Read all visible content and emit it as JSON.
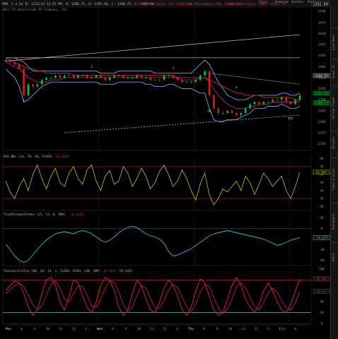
{
  "header": {
    "symbol": "SPX",
    "timeframe": "5 d 5m",
    "bar_info": "D: 3/22/12 12:35 PM, O: 1396.75, H: 1392.86, L: 1390.73, C: 1392.94",
    "study_a": "SimpleMovingAvg (20, CLOSE, 0)",
    "study_b": "SimpleMovingAvg (200, CLOSE, 0)",
    "study_c": "SimpleMovingAvg (1000, CLOSE, 0)",
    "copyright": "2012 TD Ameritrade IP Company, Inc.",
    "toolbar": [
      "Style",
      "Drawings",
      "Studies",
      "Patterns"
    ],
    "last_price": "1392.94"
  },
  "sidebar": {
    "tabs": [
      "Live News",
      "Level II",
      "Active Trader",
      "Options",
      "Times & Sales",
      "Dashboard",
      "Watch"
    ]
  },
  "price_panel": {
    "y_labels": [
      "1430",
      "1425",
      "1420",
      "1415",
      "1410",
      "1405",
      "1400",
      "1395",
      "1390",
      "1385",
      "1380",
      "1375",
      "1370"
    ],
    "markers": [
      "1",
      "2",
      "3",
      "4",
      "16",
      "E?F"
    ],
    "price_tags": [
      {
        "text": "1400.93",
        "color": "#cccccc"
      },
      {
        "text": "1392.94",
        "color": "#00cc44"
      },
      {
        "text": "1389.57",
        "color": "#00cc44"
      }
    ]
  },
  "rsi_panel": {
    "title": "RSI_BBs (14, 70, 30, CLOSE)",
    "value": "62.8419",
    "badge": "62.847",
    "levels": [
      "80",
      "70",
      "60",
      "50",
      "40",
      "30",
      "20"
    ]
  },
  "tsi_panel": {
    "title": "TrueStrengthIndex (25, 13, 8, EMA)",
    "value": "-16.8243",
    "badge": "-16.824",
    "levels": [
      "20",
      "0",
      "-20",
      "-40",
      "-60"
    ]
  },
  "stoch_panel": {
    "title": "StochasticSlow (80, 20, 14, 3, CLOSE, HIGH, LOW, SMA)",
    "values": [
      "82.0947",
      "59.4435"
    ],
    "badges": [
      "82.09",
      "59.44"
    ],
    "levels": [
      "100",
      "80",
      "60",
      "40",
      "20",
      "0"
    ]
  },
  "x_axis": {
    "ticks": [
      "Mon",
      "8",
      "9",
      "10",
      "11",
      "12",
      "1:",
      "Wed",
      "8",
      "9",
      "10",
      "11",
      "12",
      "1:",
      "Thu",
      "8",
      "9",
      "10",
      "11",
      "12",
      "1:",
      "Fri",
      "8"
    ]
  },
  "colors": {
    "background": "#000000",
    "candle_up": "#00cc33",
    "candle_down": "#dd2222",
    "bollinger": "#8899ee",
    "ma_magenta": "#cc2288",
    "ma_red": "#ee3333",
    "rsi_line": "#ccbb33",
    "tsi_line": "#33bbcc",
    "stoch_k": "#ee2222",
    "stoch_d": "#aa2266",
    "level_red": "#cc2222",
    "level_cyan": "#33cccc"
  },
  "chart_data": [
    {
      "type": "line",
      "name": "price",
      "ylim": [
        1367,
        1432
      ],
      "close": [
        1408,
        1407,
        1406,
        1404,
        1392,
        1397,
        1396,
        1397,
        1399,
        1400,
        1400,
        1401,
        1400,
        1401,
        1401,
        1400,
        1401,
        1401,
        1400,
        1400,
        1401,
        1400,
        1399,
        1400,
        1401,
        1401,
        1400,
        1400,
        1400,
        1401,
        1400,
        1400,
        1399,
        1399,
        1399,
        1401,
        1401,
        1400,
        1399,
        1398,
        1398,
        1398,
        1399,
        1401,
        1403,
        1392,
        1386,
        1384,
        1384,
        1385,
        1384,
        1383,
        1384,
        1386,
        1388,
        1389,
        1388,
        1389,
        1389,
        1390,
        1390,
        1391,
        1389,
        1388,
        1390,
        1392
      ],
      "bollinger_upper": [
        1409,
        1409,
        1409,
        1408,
        1407,
        1405,
        1403,
        1403,
        1403,
        1403,
        1403,
        1403,
        1403,
        1403,
        1403,
        1403,
        1403,
        1403,
        1403,
        1403,
        1403,
        1402,
        1402,
        1402,
        1402,
        1403,
        1403,
        1403,
        1403,
        1403,
        1403,
        1403,
        1403,
        1402,
        1402,
        1402,
        1402,
        1402,
        1402,
        1402,
        1402,
        1402,
        1404,
        1406,
        1408,
        1406,
        1402,
        1398,
        1395,
        1392,
        1391,
        1390,
        1390,
        1390,
        1391,
        1392,
        1392,
        1392,
        1392,
        1392,
        1392,
        1393,
        1393,
        1392,
        1392,
        1393
      ],
      "bollinger_lower": [
        1404,
        1402,
        1400,
        1396,
        1389,
        1390,
        1392,
        1394,
        1396,
        1397,
        1398,
        1398,
        1398,
        1398,
        1398,
        1398,
        1398,
        1398,
        1398,
        1398,
        1398,
        1397,
        1397,
        1397,
        1397,
        1398,
        1398,
        1398,
        1398,
        1398,
        1398,
        1397,
        1397,
        1396,
        1396,
        1396,
        1397,
        1397,
        1396,
        1395,
        1395,
        1395,
        1394,
        1393,
        1393,
        1386,
        1381,
        1380,
        1380,
        1381,
        1381,
        1381,
        1382,
        1383,
        1384,
        1386,
        1386,
        1386,
        1387,
        1387,
        1387,
        1388,
        1387,
        1386,
        1386,
        1387
      ],
      "ma_magenta": [
        1407,
        1406,
        1405,
        1404,
        1402,
        1400,
        1399,
        1398,
        1398,
        1398,
        1399,
        1399,
        1399,
        1400,
        1400,
        1400,
        1400,
        1400,
        1400,
        1400,
        1400,
        1400,
        1400,
        1400,
        1400,
        1400,
        1400,
        1400,
        1400,
        1400,
        1400,
        1400,
        1400,
        1400,
        1400,
        1400,
        1400,
        1400,
        1400,
        1399,
        1399,
        1399,
        1399,
        1400,
        1400,
        1398,
        1395,
        1392,
        1390,
        1388,
        1387,
        1386,
        1386,
        1386,
        1387,
        1387,
        1388,
        1388,
        1388,
        1389,
        1389,
        1389,
        1389,
        1389,
        1389,
        1389
      ],
      "ma_red": [
        1409,
        1408,
        1407,
        1406,
        1405,
        1404,
        1404,
        1403,
        1403,
        1402,
        1402,
        1402,
        1402,
        1402,
        1402,
        1401,
        1401,
        1401,
        1401,
        1401,
        1401,
        1401,
        1401,
        1401,
        1401,
        1401,
        1401,
        1401,
        1401,
        1401,
        1401,
        1401,
        1401,
        1401,
        1401,
        1401,
        1401,
        1401,
        1400,
        1400,
        1400,
        1400,
        1400,
        1400,
        1400,
        1399,
        1398,
        1397,
        1396,
        1395,
        1394,
        1393,
        1393,
        1392,
        1392,
        1392,
        1392,
        1391,
        1391,
        1391,
        1391,
        1391,
        1391,
        1391,
        1390,
        1390
      ],
      "trendlines": [
        {
          "from": [
            0,
            1407.5
          ],
          "to": [
            65,
            1419.5
          ],
          "color": "#cccccc"
        },
        {
          "from": [
            0,
            1409
          ],
          "to": [
            65,
            1409
          ],
          "color": "#cccccc"
        },
        {
          "from": [
            45,
            1402
          ],
          "to": [
            65,
            1397
          ],
          "color": "#888888"
        },
        {
          "from": [
            13,
            1375
          ],
          "to": [
            65,
            1383
          ],
          "color": "#cccccc",
          "dashed": true
        }
      ]
    },
    {
      "type": "line",
      "name": "RSI",
      "ylim": [
        15,
        85
      ],
      "levels": [
        70,
        30
      ],
      "values": [
        52,
        38,
        30,
        45,
        55,
        40,
        60,
        72,
        55,
        42,
        58,
        68,
        50,
        45,
        62,
        70,
        55,
        48,
        66,
        72,
        52,
        40,
        58,
        65,
        48,
        52,
        70,
        62,
        45,
        55,
        68,
        58,
        42,
        50,
        64,
        72,
        60,
        45,
        52,
        66,
        55,
        40,
        28,
        48,
        62,
        35,
        22,
        30,
        42,
        38,
        45,
        52,
        40,
        58,
        50,
        35,
        48,
        62,
        55,
        45,
        52,
        58,
        40,
        30,
        45,
        63
      ]
    },
    {
      "type": "line",
      "name": "TSI",
      "ylim": [
        -70,
        30
      ],
      "levels": [
        0
      ],
      "values": [
        -30,
        -40,
        -52,
        -60,
        -64,
        -60,
        -50,
        -40,
        -30,
        -22,
        -16,
        -10,
        -8,
        -6,
        -8,
        -10,
        -6,
        -4,
        -6,
        -10,
        -16,
        -22,
        -26,
        -22,
        -16,
        -8,
        -2,
        2,
        4,
        2,
        -4,
        -10,
        -14,
        -16,
        -20,
        -28,
        -44,
        -52,
        -50,
        -46,
        -42,
        -38,
        -32,
        -26,
        -20,
        -14,
        -10,
        -8,
        -6,
        -4,
        -6,
        -8,
        -10,
        -12,
        -14,
        -16,
        -18,
        -20,
        -24,
        -28,
        -32,
        -30,
        -26,
        -22,
        -20,
        -17
      ]
    },
    {
      "type": "line",
      "name": "Stochastic",
      "ylim": [
        0,
        100
      ],
      "levels": [
        80,
        20
      ],
      "k": [
        60,
        70,
        78,
        75,
        55,
        30,
        15,
        25,
        55,
        80,
        85,
        70,
        40,
        25,
        50,
        80,
        75,
        50,
        30,
        20,
        40,
        70,
        85,
        80,
        60,
        30,
        15,
        25,
        55,
        80,
        70,
        45,
        25,
        20,
        40,
        65,
        80,
        70,
        50,
        25,
        15,
        30,
        60,
        82,
        75,
        50,
        25,
        15,
        20,
        45,
        70,
        85,
        70,
        45,
        30,
        20,
        35,
        60,
        75,
        60,
        40,
        25,
        20,
        35,
        60,
        82
      ],
      "d": [
        55,
        62,
        70,
        74,
        68,
        52,
        35,
        25,
        32,
        52,
        72,
        78,
        65,
        45,
        40,
        55,
        68,
        68,
        52,
        33,
        30,
        45,
        65,
        78,
        75,
        58,
        35,
        22,
        30,
        52,
        70,
        65,
        45,
        30,
        28,
        42,
        62,
        72,
        66,
        48,
        30,
        22,
        35,
        58,
        72,
        68,
        48,
        28,
        18,
        27,
        45,
        67,
        75,
        66,
        48,
        32,
        25,
        38,
        57,
        65,
        58,
        42,
        28,
        25,
        38,
        59
      ]
    }
  ]
}
